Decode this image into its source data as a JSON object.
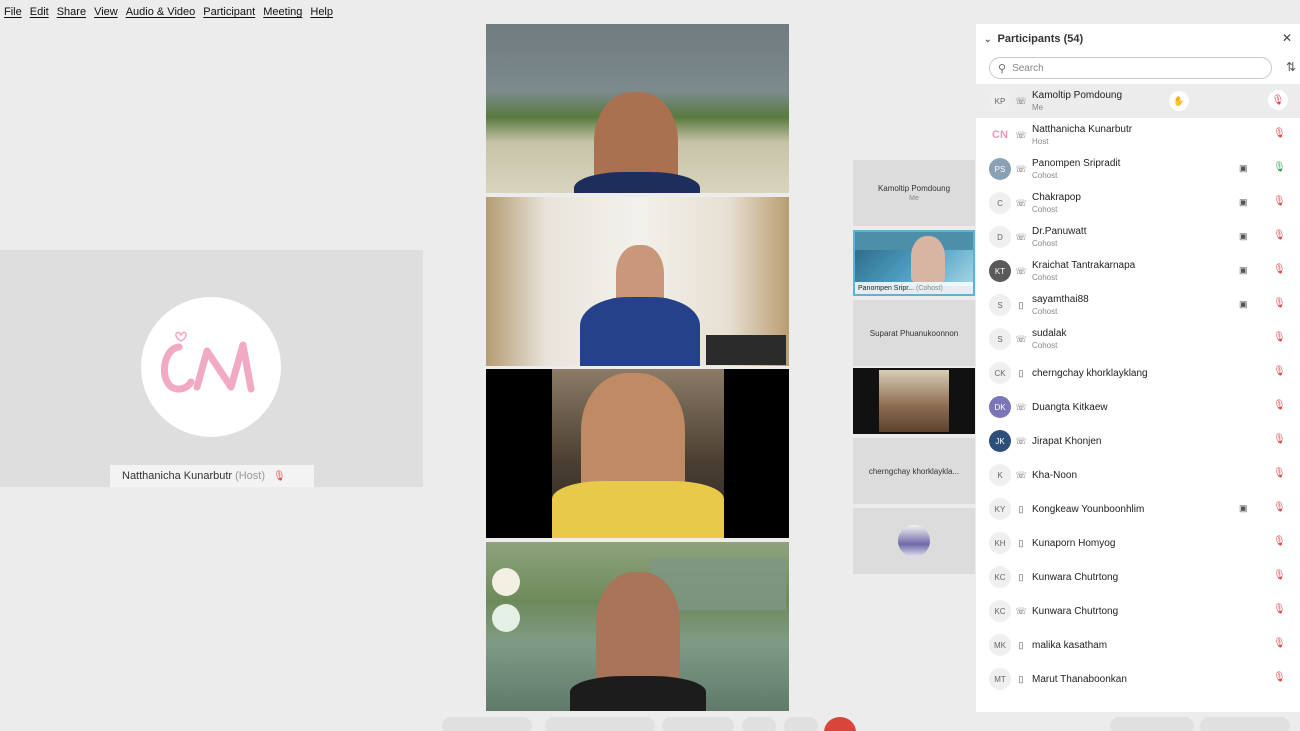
{
  "menu": [
    "File",
    "Edit",
    "Share",
    "View",
    "Audio & Video",
    "Participant",
    "Meeting",
    "Help"
  ],
  "main_speaker": {
    "name": "Natthanicha Kunarbutr",
    "role": "(Host)"
  },
  "thumbnails": [
    {
      "name": "Kamoltip Pomdoung",
      "sub": "Me"
    },
    {
      "name": "Panompen Sripr...",
      "sub": "(Cohost)"
    },
    {
      "name": "Suparat Phuanukoonnon"
    },
    {
      "name": "cherngchay khorklaykla..."
    }
  ],
  "participants_panel": {
    "title": "Participants (54)",
    "search_placeholder": "Search",
    "items": [
      {
        "initials": "KP",
        "name": "Kamoltip Pomdoung",
        "role": "Me",
        "camera": false,
        "mic": "muted"
      },
      {
        "initials": "CN",
        "name": "Natthanicha Kunarbutr",
        "role": "Host",
        "camera": false,
        "mic": "muted"
      },
      {
        "initials": "PS",
        "name": "Panompen Sripradit",
        "role": "Cohost",
        "camera": true,
        "mic": "on"
      },
      {
        "initials": "C",
        "name": "Chakrapop",
        "role": "Cohost",
        "camera": true,
        "mic": "muted"
      },
      {
        "initials": "D",
        "name": "Dr.Panuwatt",
        "role": "Cohost",
        "camera": true,
        "mic": "muted"
      },
      {
        "initials": "KT",
        "name": "Kraichat Tantrakarnapa",
        "role": "Cohost",
        "camera": true,
        "mic": "muted"
      },
      {
        "initials": "S",
        "name": "sayamthai88",
        "role": "Cohost",
        "camera": true,
        "mic": "muted"
      },
      {
        "initials": "S",
        "name": "sudalak",
        "role": "Cohost",
        "camera": false,
        "mic": "muted"
      },
      {
        "initials": "CK",
        "name": "cherngchay khorklayklang",
        "role": "",
        "camera": false,
        "mic": "muted"
      },
      {
        "initials": "DK",
        "name": "Duangta Kitkaew",
        "role": "",
        "camera": false,
        "mic": "muted"
      },
      {
        "initials": "JK",
        "name": "Jirapat Khonjen",
        "role": "",
        "camera": false,
        "mic": "muted"
      },
      {
        "initials": "K",
        "name": "Kha-Noon",
        "role": "",
        "camera": false,
        "mic": "muted"
      },
      {
        "initials": "KY",
        "name": "Kongkeaw Younboonhlim",
        "role": "",
        "camera": true,
        "mic": "muted"
      },
      {
        "initials": "KH",
        "name": "Kunaporn Homyog",
        "role": "",
        "camera": false,
        "mic": "muted"
      },
      {
        "initials": "KC",
        "name": "Kunwara Chutrtong",
        "role": "",
        "camera": false,
        "mic": "muted"
      },
      {
        "initials": "KC",
        "name": "Kunwara Chutrtong",
        "role": "",
        "camera": false,
        "mic": "muted"
      },
      {
        "initials": "MK",
        "name": "malika kasatham",
        "role": "",
        "camera": false,
        "mic": "muted"
      },
      {
        "initials": "MT",
        "name": "Marut Thanaboonkan",
        "role": "",
        "camera": false,
        "mic": "muted"
      }
    ]
  }
}
